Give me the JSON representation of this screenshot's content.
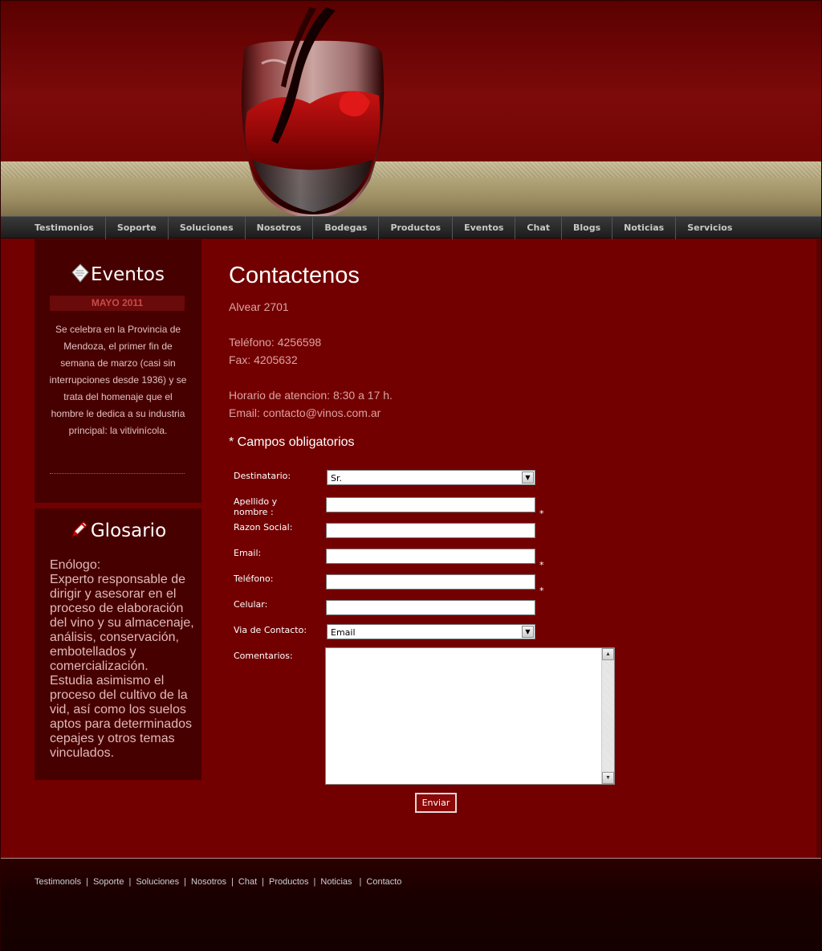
{
  "nav": {
    "items": [
      "Testimonios",
      "Soporte",
      "Soluciones",
      "Nosotros",
      "Bodegas",
      "Productos",
      "Eventos",
      "Chat",
      "Blogs",
      "Noticias",
      "Servicios"
    ]
  },
  "sidebar": {
    "eventos": {
      "title": "Eventos",
      "month": "MAYO 2011",
      "text": "Se celebra en la Provincia de Mendoza, el primer fin de semana de marzo (casi sin interrupciones desde 1936) y se trata del homenaje que el hombre le dedica a su industria principal: la vitivinícola."
    },
    "glosario": {
      "title": "Glosario",
      "term": "Enólogo:",
      "text": "Experto responsable de dirigir y asesorar en el proceso de elaboración del vino y su almacenaje, análisis, conservación, embotellados y comercialización. Estudia asimismo el proceso del cultivo de la vid, así como los suelos aptos para determinados cepajes y otros temas vinculados."
    }
  },
  "content": {
    "title": "Contactenos",
    "address": "Alvear 2701",
    "phone": "Teléfono: 4256598",
    "fax": "Fax: 4205632",
    "hours": "Horario de atencion: 8:30 a 17 h.",
    "email": "Email: contacto@vinos.com.ar",
    "required_note": "* Campos obligatorios"
  },
  "form": {
    "destinatario_label": "Destinatario:",
    "destinatario_value": "Sr.",
    "apellido_label": "Apellido y nombre :",
    "razon_label": "Razon Social:",
    "email_label": "Email:",
    "telefono_label": "Teléfono:",
    "celular_label": "Celular:",
    "via_label": "Via de Contacto:",
    "via_value": "Email",
    "comentarios_label": "Comentarios:",
    "required_mark": "*",
    "submit_label": "Enviar"
  },
  "footer": {
    "links": [
      "Testimonols",
      "Soporte",
      "Soluciones",
      "Nosotros",
      "Chat",
      "Productos",
      "Noticias",
      "Contacto"
    ],
    "separator": "|"
  }
}
